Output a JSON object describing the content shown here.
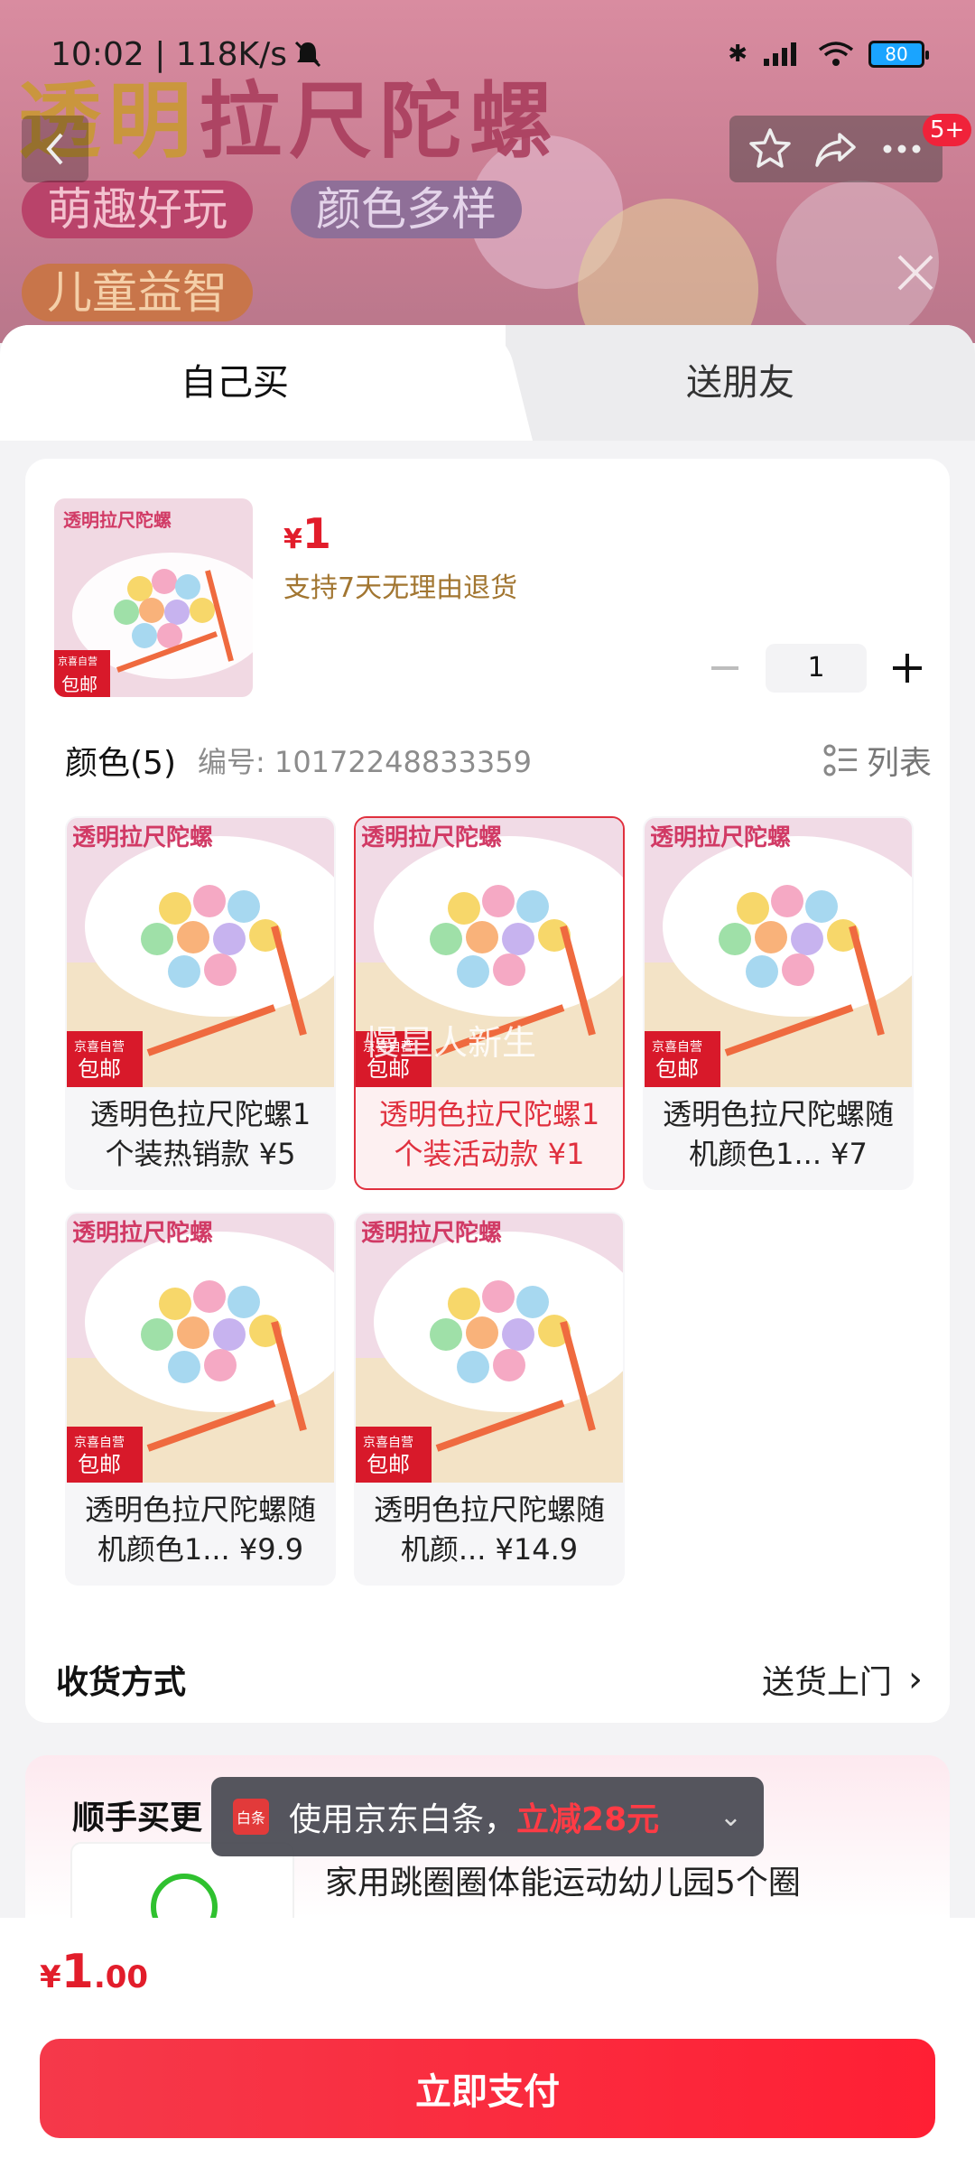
{
  "status_bar": {
    "time": "10:02 | 118K/s",
    "battery": "80"
  },
  "banner": {
    "title_prefix": "透明",
    "title_rest": "拉尺陀螺",
    "tags": [
      "萌趣好玩",
      "颜色多样",
      "儿童益智"
    ],
    "notification_badge": "5+"
  },
  "tabs": [
    {
      "label": "自己买",
      "selected": true
    },
    {
      "label": "送朋友",
      "selected": false
    }
  ],
  "product": {
    "thumb_title": "透明拉尺陀螺",
    "thumb_badge_top": "京喜自营",
    "thumb_badge_bottom": "包邮",
    "price_symbol": "¥",
    "price": "1",
    "return_policy": "支持7天无理由退货",
    "quantity": "1"
  },
  "color_section": {
    "title": "颜色(5)",
    "sku": "编号: 10172248833359",
    "list_toggle": "列表"
  },
  "variants": [
    {
      "caption": "透明色拉尺陀螺1个装热销款 ¥5",
      "selected": false
    },
    {
      "caption": "透明色拉尺陀螺1个装活动款 ¥1",
      "selected": true,
      "watermark": "慢星人新生"
    },
    {
      "caption": "透明色拉尺陀螺随机颜色1... ¥7",
      "selected": false
    },
    {
      "caption": "透明色拉尺陀螺随机颜色1... ¥9.9",
      "selected": false
    },
    {
      "caption": "透明色拉尺陀螺随机颜... ¥14.9",
      "selected": false
    }
  ],
  "shipping": {
    "label": "收货方式",
    "value": "送货上门",
    "chevron": "›"
  },
  "more": {
    "title": "顺手买更",
    "item_name": "家用跳圈圈体能运动幼儿园5个圈"
  },
  "toast": {
    "icon_text": "白条",
    "text": "使用京东白条，",
    "highlight": "立减28元",
    "chevron": "⌄"
  },
  "footer": {
    "symbol": "¥",
    "integer": "1",
    "decimal": ".00",
    "pay_label": "立即支付"
  },
  "colors": {
    "accent": "#E21D2B",
    "return_text": "#A27631",
    "pay_gradient_start": "#F5394A",
    "pay_gradient_end": "#FF1F34"
  }
}
